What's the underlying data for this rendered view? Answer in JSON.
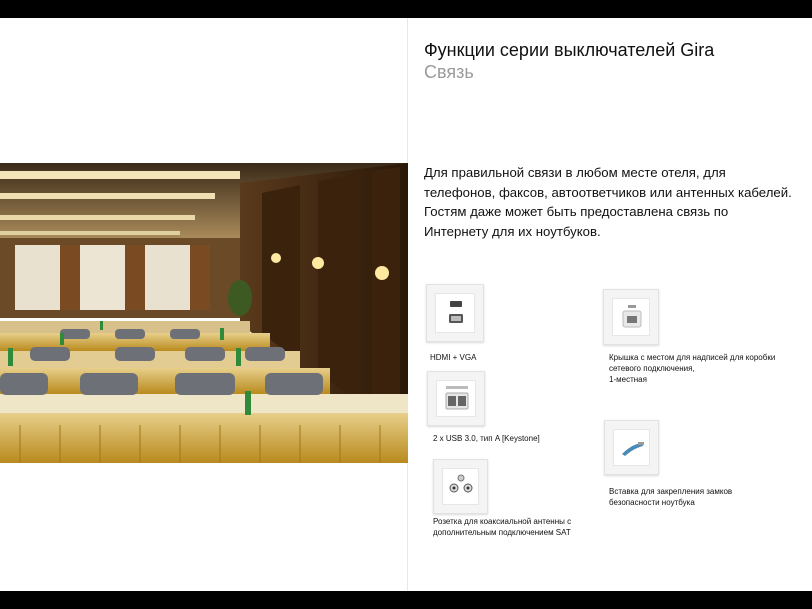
{
  "slide": {
    "title": "Функции серии выключателей Gira",
    "subtitle": "Связь",
    "body": "Для правильной связи в любом месте отеля, для телефонов, факсов, автоответчиков или антенных кабелей. Гостям даже может быть предоставлена связь по Интернету для их ноутбуков."
  },
  "products": [
    {
      "caption": "HDMI + VGA",
      "icon": "hdmi-vga-socket"
    },
    {
      "caption": "Крышка с местом для надписей для коробки сетевого подключения,\n1-местная",
      "icon": "network-socket-cover"
    },
    {
      "caption": "2 x USB 3.0, тип A [Keystone]",
      "icon": "usb-socket"
    },
    {
      "caption": "Вставка для закрепления замков безопасности ноутбука",
      "icon": "laptop-lock-insert"
    },
    {
      "caption": "Розетка для коаксиальной антенны с дополнительным подключением SAT",
      "icon": "coax-antenna-socket"
    }
  ],
  "photo": {
    "icon": "conference-room-photo"
  },
  "colors": {
    "bar": "#000000",
    "subtitle": "#9a9a9a",
    "tablecloth": "#c9a02a"
  }
}
